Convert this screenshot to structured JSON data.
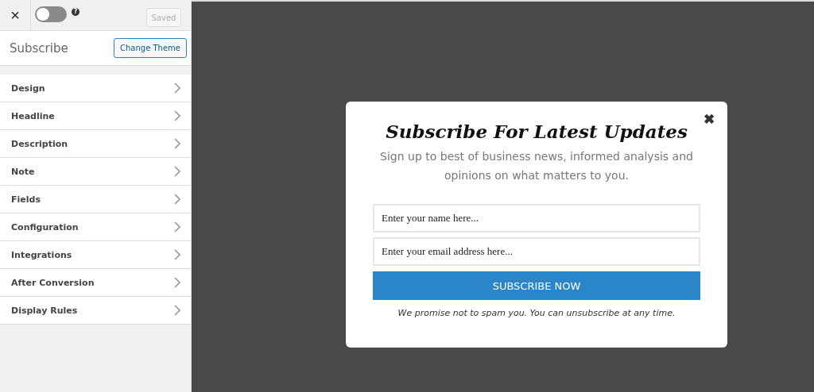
{
  "toolbar": {
    "close": "×",
    "toggle": {
      "on": false
    },
    "help": "?",
    "saved_button": {
      "label": "Saved",
      "disabled": true
    }
  },
  "header": {
    "title": "Subscribe",
    "change_theme": "Change Theme"
  },
  "menu": [
    {
      "label": "Design"
    },
    {
      "label": "Headline"
    },
    {
      "label": "Description"
    },
    {
      "label": "Note"
    },
    {
      "label": "Fields"
    },
    {
      "label": "Configuration"
    },
    {
      "label": "Integrations"
    },
    {
      "label": "After Conversion"
    },
    {
      "label": "Display Rules"
    }
  ],
  "popup": {
    "close": "✖",
    "headline": "Subscribe For Latest Updates",
    "description": "Sign up to best of business news, informed analysis and opinions on what matters to you.",
    "fields": [
      {
        "placeholder": "Enter your name here..."
      },
      {
        "placeholder": "Enter your email address here..."
      }
    ],
    "button": "SUBSCRIBE NOW",
    "note": "We promise not to spam you. You can unsubscribe at any time."
  }
}
